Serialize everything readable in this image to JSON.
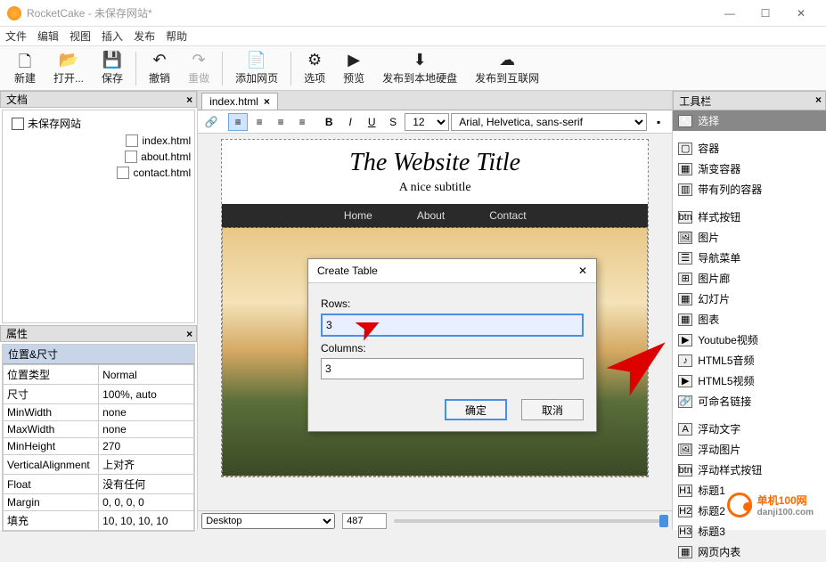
{
  "titlebar": {
    "app": "RocketCake",
    "doc": "未保存网站*"
  },
  "menu": [
    "文件",
    "编辑",
    "视图",
    "插入",
    "发布",
    "帮助"
  ],
  "toolbar": {
    "new": "新建",
    "open": "打开...",
    "save": "保存",
    "undo": "撤销",
    "redo": "重做",
    "addpage": "添加网页",
    "options": "选项",
    "preview": "预览",
    "pub_local": "发布到本地硬盘",
    "pub_net": "发布到互联网"
  },
  "panels": {
    "docs": "文档",
    "props": "属性",
    "tools": "工具栏",
    "pos": "位置&尺寸"
  },
  "tree": {
    "root": "未保存网站",
    "items": [
      "index.html",
      "about.html",
      "contact.html"
    ]
  },
  "props": [
    [
      "位置类型",
      "Normal"
    ],
    [
      "尺寸",
      "100%, auto"
    ],
    [
      "MinWidth",
      "none"
    ],
    [
      "MaxWidth",
      "none"
    ],
    [
      "MinHeight",
      "270"
    ],
    [
      "VerticalAlignment",
      "上对齐"
    ],
    [
      "Float",
      "没有任何"
    ],
    [
      "Margin",
      "0, 0, 0, 0"
    ],
    [
      "填充",
      "10, 10, 10, 10"
    ]
  ],
  "tab": {
    "name": "index.html"
  },
  "fmt": {
    "fontsize": "12",
    "fontfamily": "Arial, Helvetica, sans-serif"
  },
  "page": {
    "title": "The Website Title",
    "subtitle": "A nice subtitle",
    "nav": [
      "Home",
      "About",
      "Contact"
    ]
  },
  "status": {
    "device": "Desktop",
    "width": "487"
  },
  "tools": {
    "select": "选择",
    "items": [
      "容器",
      "渐变容器",
      "带有列的容器"
    ],
    "items2": [
      "样式按钮",
      "图片",
      "导航菜单",
      "图片廊",
      "幻灯片",
      "图表",
      "Youtube视频",
      "HTML5音频",
      "HTML5视频",
      "可命名链接"
    ],
    "items3": [
      "浮动文字",
      "浮动图片",
      "浮动样式按钮",
      "标题1",
      "标题2",
      "标题3",
      "网页内表"
    ]
  },
  "dialog": {
    "title": "Create Table",
    "rows_label": "Rows:",
    "rows_val": "3",
    "cols_label": "Columns:",
    "cols_val": "3",
    "ok": "确定",
    "cancel": "取消"
  },
  "watermark": "单机100网",
  "watermark_url": "danji100.com"
}
